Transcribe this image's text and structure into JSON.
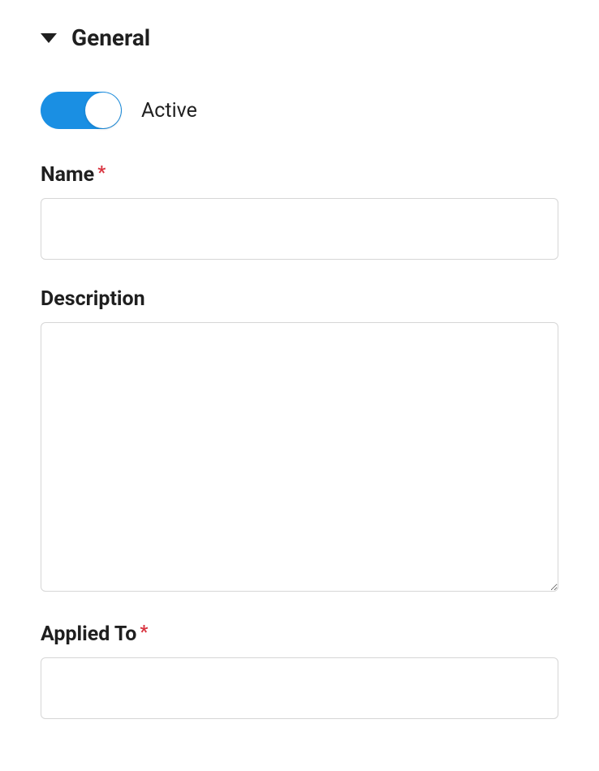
{
  "section": {
    "title": "General"
  },
  "fields": {
    "active": {
      "label": "Active",
      "value": true
    },
    "name": {
      "label": "Name",
      "value": ""
    },
    "description": {
      "label": "Description",
      "value": ""
    },
    "applied_to": {
      "label": "Applied To",
      "value": ""
    }
  },
  "required_marker": "*"
}
